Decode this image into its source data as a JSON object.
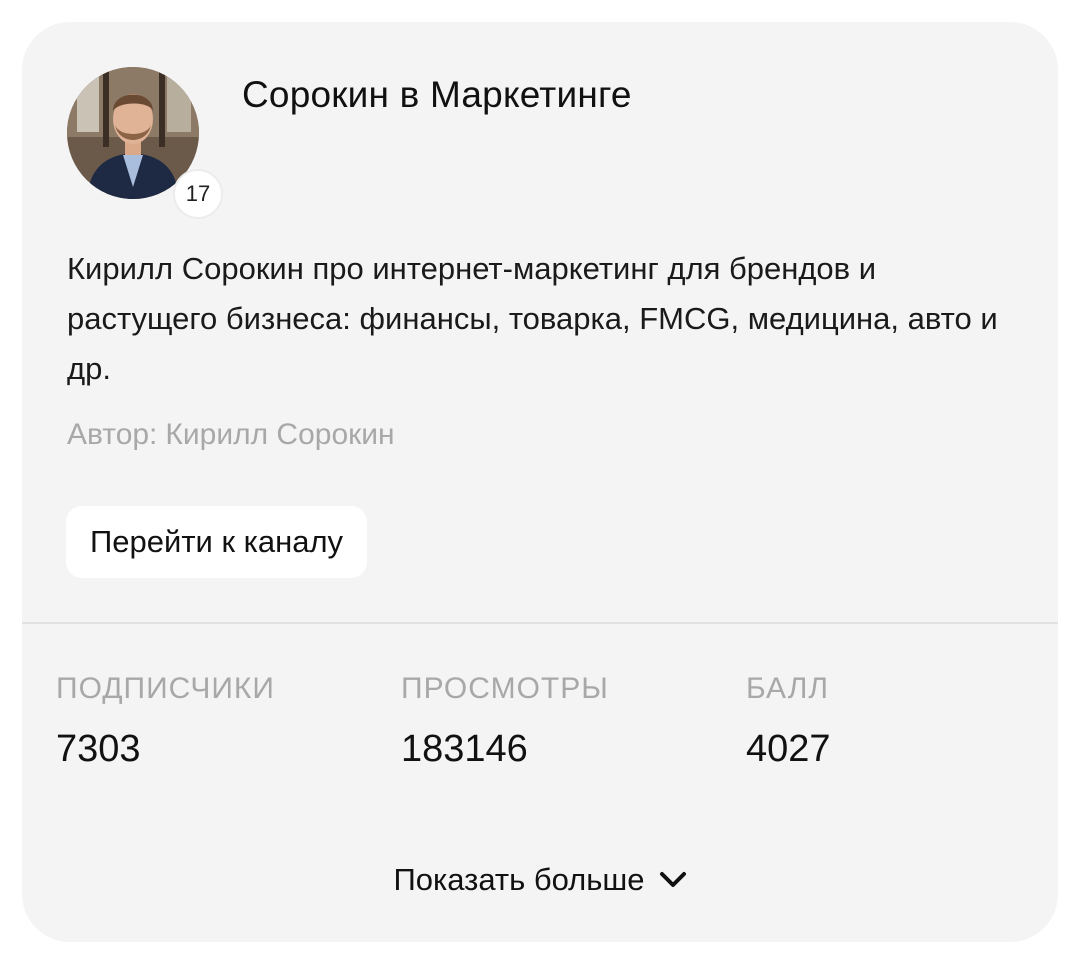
{
  "channel": {
    "title": "Сорокин в Маркетинге",
    "level": "17",
    "avatar_icon": "person-photo-avatar",
    "description": "Кирилл Сорокин про интернет-маркетинг для брендов и растущего бизнеса: финансы, товарка, FMCG, медицина, авто и др.",
    "author_label": "Автор:",
    "author_name": "Кирилл Сорокин"
  },
  "actions": {
    "goto_label": "Перейти к каналу",
    "show_more_label": "Показать больше",
    "show_more_icon": "chevron-down-icon"
  },
  "stats": [
    {
      "label": "ПОДПИСЧИКИ",
      "value": "7303"
    },
    {
      "label": "ПРОСМОТРЫ",
      "value": "183146"
    },
    {
      "label": "БАЛЛ",
      "value": "4027"
    }
  ],
  "colors": {
    "card_background": "#f4f4f4",
    "muted_text": "#a8a8a8",
    "button_background": "#ffffff"
  }
}
